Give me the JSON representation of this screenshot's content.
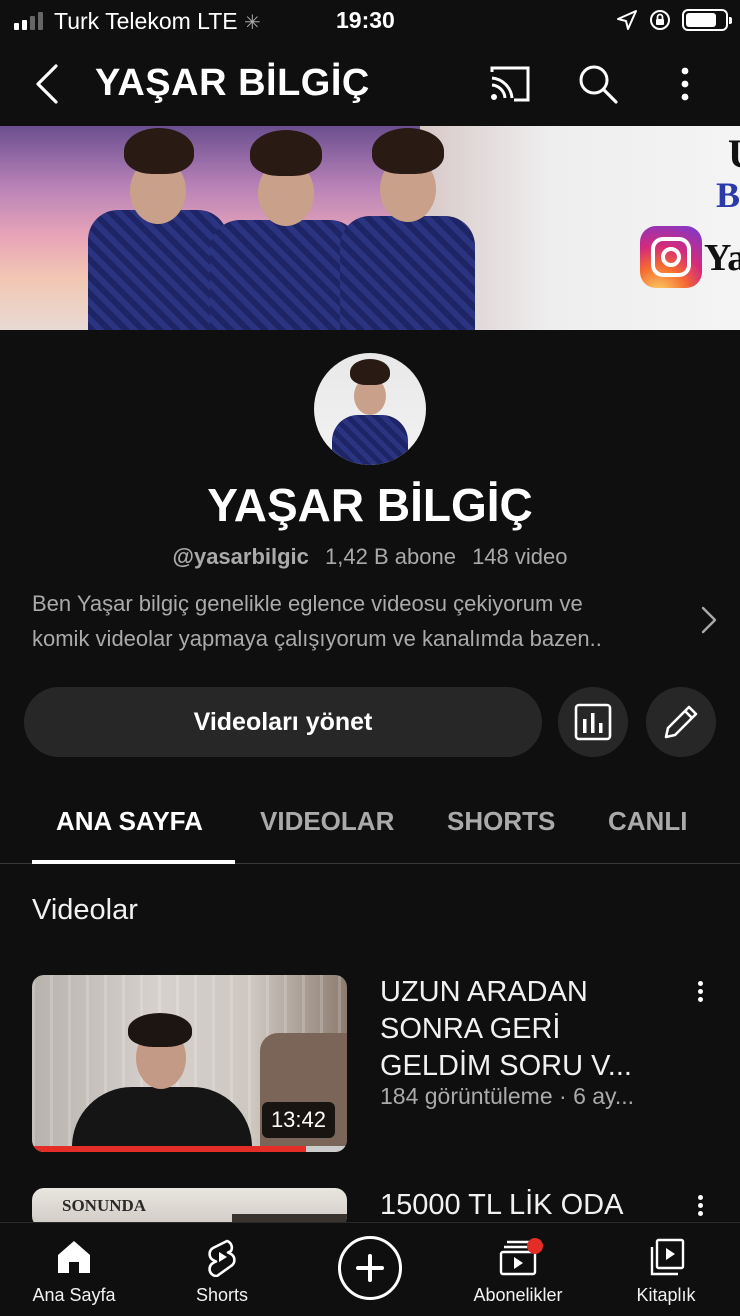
{
  "status_bar": {
    "carrier": "Turk Telekom",
    "network": "LTE",
    "time": "19:30"
  },
  "header": {
    "title": "YAŞAR BİLGİÇ",
    "icons": [
      "back-icon",
      "cast-icon",
      "search-icon",
      "more-vert-icon"
    ]
  },
  "banner": {
    "letters": [
      "B",
      "Ya"
    ]
  },
  "channel": {
    "name": "YAŞAR BİLGİÇ",
    "handle": "@yasarbilgic",
    "subscribers": "1,42 B abone",
    "videos": "148 video",
    "description_line1": "Ben Yaşar bilgiç  genelikle eglence videosu çekiyorum ve",
    "description_line2": "komik videolar yapmaya çalışıyorum ve kanalımda  bazen.."
  },
  "actions": {
    "manage_label": "Videoları yönet",
    "analytics_icon": "analytics-icon",
    "edit_icon": "pencil-icon"
  },
  "tabs": [
    {
      "label": "ANA SAYFA",
      "active": true
    },
    {
      "label": "VIDEOLAR",
      "active": false
    },
    {
      "label": "SHORTS",
      "active": false
    },
    {
      "label": "CANLI",
      "active": false
    }
  ],
  "section": {
    "title": "Videolar"
  },
  "videos": [
    {
      "title_line1": "UZUN ARADAN",
      "title_line2": "SONRA GERİ",
      "title_line3": "GELDİM  SORU V...",
      "meta": "184 görüntüleme · 6 ay...",
      "duration": "13:42",
      "watched_fraction": 0.87
    },
    {
      "title_line1": "15000 TL LİK ODA",
      "thumb_text": "SONUNDA"
    }
  ],
  "bottom_nav": [
    {
      "label": "Ana Sayfa",
      "icon": "home-icon"
    },
    {
      "label": "Shorts",
      "icon": "shorts-icon"
    },
    {
      "label": "",
      "icon": "create-plus-icon"
    },
    {
      "label": "Abonelikler",
      "icon": "subscriptions-icon"
    },
    {
      "label": "Kitaplık",
      "icon": "library-icon"
    }
  ],
  "colors": {
    "background": "#0f0f0f",
    "surface": "#272727",
    "accent_red": "#e52d27",
    "secondary_text": "#aaaaaa"
  }
}
